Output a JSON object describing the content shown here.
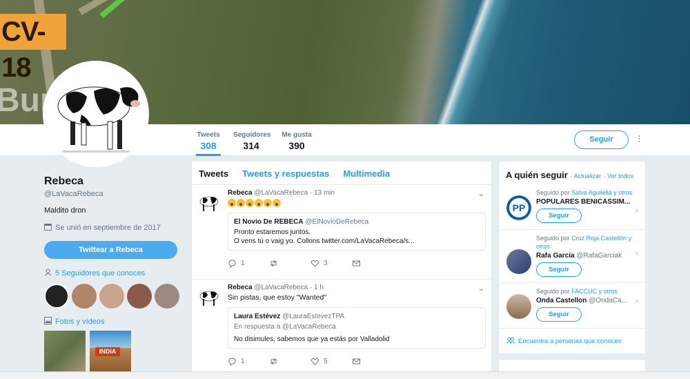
{
  "banner": {
    "road_sign": "CV-18",
    "town_fragment": "Bur"
  },
  "nav": {
    "stats": [
      {
        "label": "Tweets",
        "value": "308"
      },
      {
        "label": "Seguidores",
        "value": "314"
      },
      {
        "label": "Me gusta",
        "value": "390"
      }
    ],
    "follow_label": "Seguir"
  },
  "profile": {
    "name": "Rebeca",
    "handle": "@LaVacaRebeca",
    "bio": "Maldito dron",
    "joined": "Se unió en septiembre de 2017",
    "tweet_to_label": "Twittear a Rebeca",
    "followers_known": "5 Seguidores que conoces",
    "photos_label": "Fotos y vídeos",
    "photo_caption": "INDIA"
  },
  "tabs": [
    "Tweets",
    "Tweets y respuestas",
    "Multimedia"
  ],
  "tweets": [
    {
      "name": "Rebeca",
      "handle": "@LaVacaRebeca",
      "time": "· 13 min",
      "text": "",
      "quote": {
        "name": "El Novio De REBECA",
        "handle": "@ElNovioDeRebeca",
        "line1": "Pronto estaremos juntos.",
        "line2": "O vens tú o vaig yo. Collons twitter.com/LaVacaRebeca/s..."
      },
      "replies": "1",
      "retweets": "",
      "likes": "3"
    },
    {
      "name": "Rebeca",
      "handle": "@LaVacaRebeca",
      "time": "· 1 h",
      "text": "Sin pistas, que estoy \"Wanted\"",
      "quote": {
        "name": "Laura Estévez",
        "handle": "@LauraEstevezTPA",
        "reply_to": "En respuesta a @LaVacaRebeca",
        "line1": "No disimules, sabemos que ya estás por Valladolid"
      },
      "replies": "1",
      "retweets": "",
      "likes": "5"
    }
  ],
  "who_to_follow": {
    "title": "A quién seguir",
    "refresh": "· Actualizar",
    "view_all": "· Ver todos",
    "follow_label": "Seguir",
    "items": [
      {
        "via_prefix": "Seguido por",
        "via_names": "Salva Aguilella y otros",
        "name": "POPULARES BENICÀSSIM...",
        "handle": ""
      },
      {
        "via_prefix": "Seguido por",
        "via_names": "Cruz Roja Castellón y otros",
        "name": "Rafa García",
        "handle": "@RafaGarciak"
      },
      {
        "via_prefix": "Seguido por",
        "via_names": "FACCUC y otros",
        "name": "Onda Castellon",
        "handle": "@OndaCa..."
      }
    ],
    "find_people": "Encuentra a personas que conoces"
  },
  "colors": {
    "accent": "#1da1f2",
    "banner_badge": "#f0a338"
  }
}
